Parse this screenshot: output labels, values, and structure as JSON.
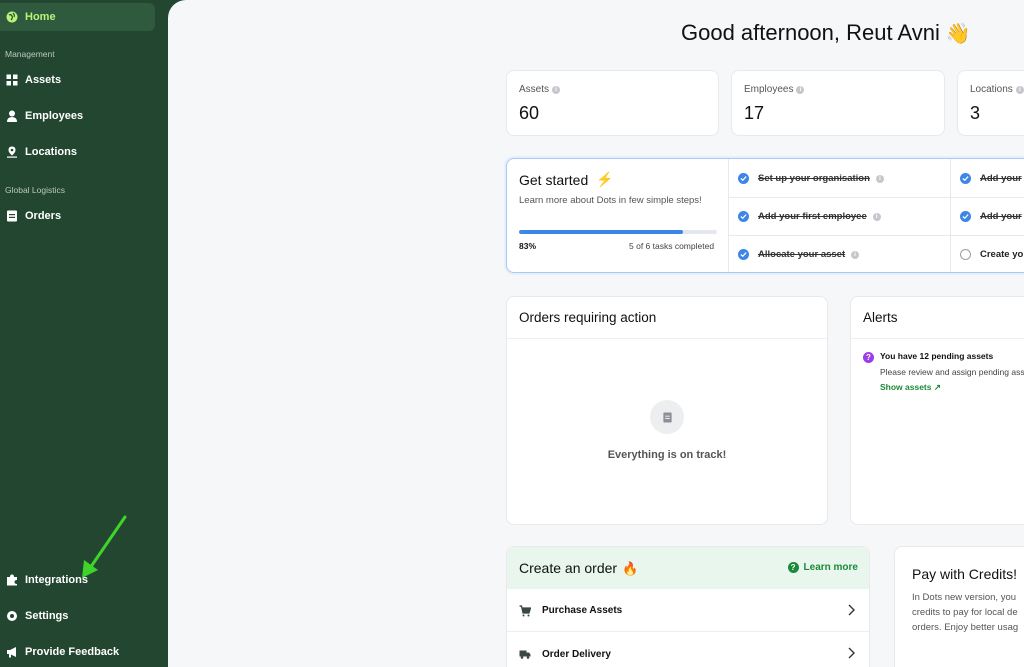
{
  "sidebar": {
    "home_label": "Home",
    "section_management": "Management",
    "assets_label": "Assets",
    "employees_label": "Employees",
    "locations_label": "Locations",
    "section_logistics": "Global Logistics",
    "orders_label": "Orders",
    "integrations_label": "Integrations",
    "settings_label": "Settings",
    "feedback_label": "Provide Feedback"
  },
  "greeting": {
    "text": "Good afternoon, Reut Avni",
    "emoji": "👋"
  },
  "stats": [
    {
      "label": "Assets",
      "value": "60"
    },
    {
      "label": "Employees",
      "value": "17"
    },
    {
      "label": "Locations",
      "value": "3"
    }
  ],
  "get_started": {
    "title": "Get started",
    "subtitle": "Learn more about Dots in few simple steps!",
    "percent_label": "83%",
    "progress_fraction": 0.83,
    "tasks_completed": "5 of 6 tasks completed",
    "tasks": [
      {
        "label": "Set up your organisation",
        "done": true
      },
      {
        "label": "Add your first employee",
        "done": true
      },
      {
        "label": "Allocate your asset",
        "done": true
      },
      {
        "label": "Add your",
        "done": true
      },
      {
        "label": "Add your",
        "done": true
      },
      {
        "label": "Create yo",
        "done": false
      }
    ]
  },
  "orders_panel": {
    "title": "Orders requiring action",
    "empty_text": "Everything is on track!"
  },
  "alerts_panel": {
    "title": "Alerts",
    "alert_title": "You have 12 pending assets",
    "alert_desc": "Please review and assign pending ass",
    "alert_link": "Show assets ↗"
  },
  "create_order": {
    "title": "Create an order",
    "learn_more": "Learn more",
    "rows": [
      {
        "label": "Purchase Assets"
      },
      {
        "label": "Order Delivery"
      }
    ]
  },
  "pay_credits": {
    "title": "Pay with Credits!",
    "lines": [
      "In Dots new version, you",
      "credits to pay for local de",
      "orders. Enjoy better usag"
    ]
  },
  "colors": {
    "sidebar": "#234630",
    "active_text": "#b8f27a",
    "accent_blue": "#3d86e8",
    "accent_green": "#1a8a3a",
    "annotation_arrow": "#3fd42a"
  }
}
